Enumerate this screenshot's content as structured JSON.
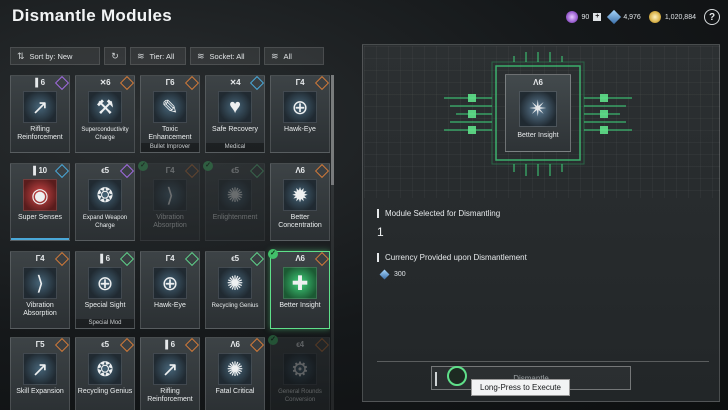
{
  "header": {
    "title": "Dismantle Modules",
    "currency_1": "90",
    "currency_2": "4,976",
    "currency_3": "1,020,884",
    "help_label": "?"
  },
  "filters": {
    "sort_label": "Sort by: New",
    "tier_label": "Tier: All",
    "socket_label": "Socket: All",
    "all_label": "All"
  },
  "modules": [
    {
      "cap": "▌6",
      "name": "Rifling Reinforcement",
      "sub": "",
      "icon": "rifle-icon",
      "glyph": "↗",
      "badge": "purple"
    },
    {
      "cap": "✕6",
      "name": "Superconductivity Charge",
      "sub": "",
      "icon": "gun-icon",
      "glyph": "⚒",
      "badge": "orange"
    },
    {
      "cap": "Γ6",
      "name": "Toxic Enhancement",
      "sub": "Bullet Improver",
      "icon": "syringe-icon",
      "glyph": "✎",
      "badge": "orange"
    },
    {
      "cap": "✕4",
      "name": "Safe Recovery",
      "sub": "Medical",
      "icon": "heart-icon",
      "glyph": "♥",
      "badge": "blue"
    },
    {
      "cap": "Γ4",
      "name": "Hawk-Eye",
      "sub": "",
      "icon": "crosshair-icon",
      "glyph": "⊕",
      "badge": "orange"
    },
    {
      "cap": "▌10",
      "name": "Super Senses",
      "sub": "",
      "icon": "eye-icon",
      "glyph": "◉",
      "badge": "blue"
    },
    {
      "cap": "ϵ5",
      "name": "Expand Weapon Charge",
      "sub": "",
      "icon": "cylinder-icon",
      "glyph": "❂",
      "badge": "purple"
    },
    {
      "cap": "Γ4",
      "name": "Vibration Absorption",
      "sub": "",
      "icon": "shock-icon",
      "glyph": "⟩",
      "badge": "orange"
    },
    {
      "cap": "ϵ5",
      "name": "Enlightenment",
      "sub": "",
      "icon": "spark-icon",
      "glyph": "✺",
      "badge": "green"
    },
    {
      "cap": "Λ6",
      "name": "Better Concentration",
      "sub": "",
      "icon": "cog-icon",
      "glyph": "✹",
      "badge": "orange"
    },
    {
      "cap": "Γ4",
      "name": "Vibration Absorption",
      "sub": "",
      "icon": "shock-icon",
      "glyph": "⟩",
      "badge": "orange"
    },
    {
      "cap": "▌6",
      "name": "Special Sight",
      "sub": "Special Mod",
      "icon": "sight-icon",
      "glyph": "⊕",
      "badge": "green"
    },
    {
      "cap": "Γ4",
      "name": "Hawk-Eye",
      "sub": "",
      "icon": "crosshair-icon",
      "glyph": "⊕",
      "badge": "green"
    },
    {
      "cap": "ϵ5",
      "name": "Recycling Genius",
      "sub": "",
      "icon": "recycle-icon",
      "glyph": "✺",
      "badge": "green"
    },
    {
      "cap": "Λ6",
      "name": "Better Insight",
      "sub": "",
      "icon": "insight-icon",
      "glyph": "✚",
      "badge": "orange"
    },
    {
      "cap": "Γ5",
      "name": "Skill Expansion",
      "sub": "",
      "icon": "expand-icon",
      "glyph": "↗",
      "badge": "orange"
    },
    {
      "cap": "ϵ5",
      "name": "Recycling Genius",
      "sub": "",
      "icon": "recycle-icon",
      "glyph": "❂",
      "badge": "orange"
    },
    {
      "cap": "▌6",
      "name": "Rifling Reinforcement",
      "sub": "",
      "icon": "rifle-icon",
      "glyph": "↗",
      "badge": "orange"
    },
    {
      "cap": "Λ6",
      "name": "Fatal Critical",
      "sub": "",
      "icon": "burst-icon",
      "glyph": "✺",
      "badge": "orange"
    },
    {
      "cap": "ϵ4",
      "name": "General Rounds Conversion",
      "sub": "",
      "icon": "rounds-icon",
      "glyph": "⚙",
      "badge": "orange"
    }
  ],
  "detail": {
    "card_cap": "Λ6",
    "card_name": "Better Insight",
    "selected_label": "Module Selected for Dismantling",
    "selected_count": "1",
    "currency_label": "Currency Provided upon Dismantlement",
    "currency_value": "300",
    "dismantle_label": "Dismantle",
    "tooltip": "Long-Press to Execute"
  }
}
